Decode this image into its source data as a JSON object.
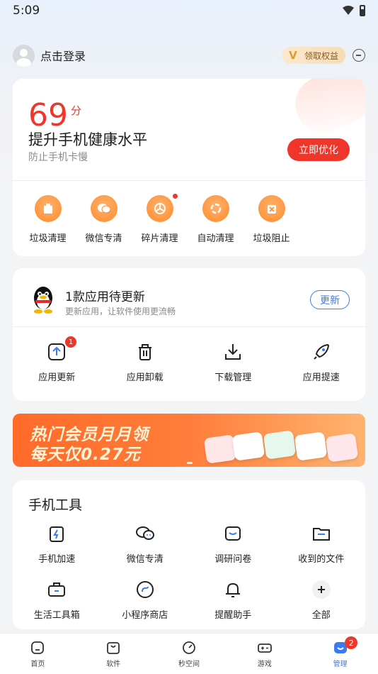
{
  "status_bar": {
    "time": "5:09"
  },
  "header": {
    "login_text": "点击登录",
    "vip_label": "领取权益"
  },
  "score_card": {
    "score": "69",
    "unit": "分",
    "title": "提升手机健康水平",
    "subtitle": "防止手机卡慢",
    "optimize_label": "立即优化",
    "quick_items": [
      {
        "label": "垃圾清理",
        "icon": "trash-box-icon"
      },
      {
        "label": "微信专清",
        "icon": "wechat-icon"
      },
      {
        "label": "碎片清理",
        "icon": "fragment-icon"
      },
      {
        "label": "自动清理",
        "icon": "auto-clean-icon"
      },
      {
        "label": "垃圾阻止",
        "icon": "block-icon"
      }
    ]
  },
  "update_card": {
    "title": "1款应用待更新",
    "subtitle": "更新应用，让软件使用更流畅",
    "update_button": "更新",
    "items": [
      {
        "label": "应用更新",
        "badge": "1"
      },
      {
        "label": "应用卸载"
      },
      {
        "label": "下载管理"
      },
      {
        "label": "应用提速"
      }
    ]
  },
  "banner": {
    "line1": "热门会员月月领",
    "line2": "每天仅0.27元"
  },
  "tools_card": {
    "title": "手机工具",
    "items": [
      {
        "label": "手机加速"
      },
      {
        "label": "微信专清"
      },
      {
        "label": "调研问卷"
      },
      {
        "label": "收到的文件"
      },
      {
        "label": "生活工具箱"
      },
      {
        "label": "小程序商店"
      },
      {
        "label": "提醒助手"
      },
      {
        "label": "全部"
      }
    ]
  },
  "bottom_nav": {
    "items": [
      {
        "label": "首页"
      },
      {
        "label": "软件"
      },
      {
        "label": "秒空间"
      },
      {
        "label": "游戏"
      },
      {
        "label": "管理",
        "badge": "2"
      }
    ]
  },
  "colors": {
    "accent_red": "#f0362a",
    "accent_blue": "#3a7cf0",
    "quick_orange": "#ff8a2c"
  }
}
